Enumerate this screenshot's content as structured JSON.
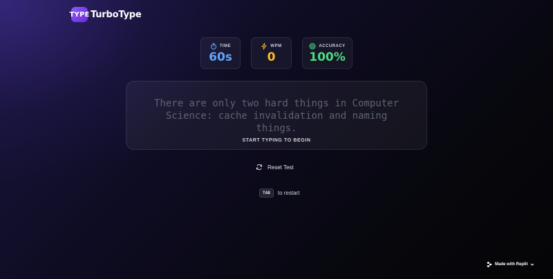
{
  "app": {
    "logo_badge": "TYPE",
    "name": "TurboType"
  },
  "stats": {
    "time": {
      "label": "TIME",
      "value": "60s",
      "icon": "timer-icon",
      "color": "#60a5fa"
    },
    "wpm": {
      "label": "WPM",
      "value": "0",
      "icon": "lightning-icon",
      "color": "#fbbf24"
    },
    "accuracy": {
      "label": "ACCURACY",
      "value": "100%",
      "icon": "target-icon",
      "color": "#4ade80"
    }
  },
  "test": {
    "text": "There are only two hard things in Computer Science: cache invalidation and naming things.",
    "hint": "START TYPING TO BEGIN"
  },
  "reset": {
    "label": "Reset Test",
    "icon": "refresh-icon"
  },
  "shortcut": {
    "key": "TAB",
    "text": "to restart"
  },
  "badge": {
    "label": "Made with Replit",
    "icon": "replit-icon"
  }
}
